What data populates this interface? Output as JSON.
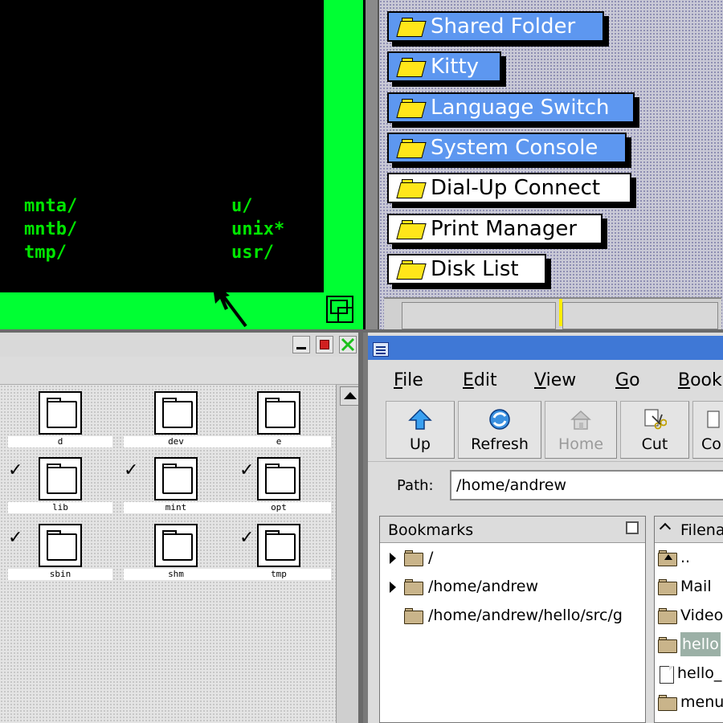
{
  "terminal": {
    "lines": [
      {
        "left": "mnta/",
        "right": "u/"
      },
      {
        "left": "mntb/",
        "right": "unix*"
      },
      {
        "left": "tmp/",
        "right": "usr/"
      }
    ],
    "colors": {
      "frame": "#00ff33",
      "text": "#00e600",
      "screen": "#000000"
    }
  },
  "launcher": {
    "items": [
      {
        "label": "Shared Folder",
        "style": "blue"
      },
      {
        "label": "Kitty",
        "style": "blue"
      },
      {
        "label": "Language Switch",
        "style": "blue"
      },
      {
        "label": "System Console",
        "style": "blue"
      },
      {
        "label": "Dial-Up Connect",
        "style": "white"
      },
      {
        "label": "Print Manager",
        "style": "white"
      },
      {
        "label": "Disk List",
        "style": "white"
      }
    ],
    "colors": {
      "blue": "#5d97f0",
      "folder": "#ffe61a"
    }
  },
  "filewindow": {
    "icons": [
      {
        "name": "d",
        "checked": false
      },
      {
        "name": "dev",
        "checked": false
      },
      {
        "name": "e",
        "checked": false
      },
      {
        "name": "lib",
        "checked": true
      },
      {
        "name": "mint",
        "checked": true
      },
      {
        "name": "opt",
        "checked": true
      },
      {
        "name": "sbin",
        "checked": true
      },
      {
        "name": "shm",
        "checked": false
      },
      {
        "name": "tmp",
        "checked": true
      }
    ],
    "check_mark": "✓"
  },
  "filemanager": {
    "title_color": "#3f78d6",
    "menu": [
      {
        "first": "F",
        "rest": "ile"
      },
      {
        "first": "E",
        "rest": "dit"
      },
      {
        "first": "V",
        "rest": "iew"
      },
      {
        "first": "G",
        "rest": "o"
      },
      {
        "first": "B",
        "rest": "ook"
      }
    ],
    "toolbar": {
      "up": "Up",
      "refresh": "Refresh",
      "home": "Home",
      "cut": "Cut",
      "copy": "Co"
    },
    "path": {
      "label": "Path:",
      "value": "/home/andrew"
    },
    "bookmarks": {
      "header": "Bookmarks",
      "items": [
        {
          "label": "/",
          "expandable": true
        },
        {
          "label": "/home/andrew",
          "expandable": true
        },
        {
          "label": "/home/andrew/hello/src/g",
          "expandable": false
        }
      ]
    },
    "files": {
      "header": "Filena",
      "items": [
        {
          "label": "..",
          "kind": "up"
        },
        {
          "label": "Mail",
          "kind": "folder"
        },
        {
          "label": "Video",
          "kind": "folder"
        },
        {
          "label": "hello",
          "kind": "folder",
          "selected": true
        },
        {
          "label": "hello_",
          "kind": "file"
        },
        {
          "label": "menu",
          "kind": "folder"
        }
      ]
    }
  }
}
